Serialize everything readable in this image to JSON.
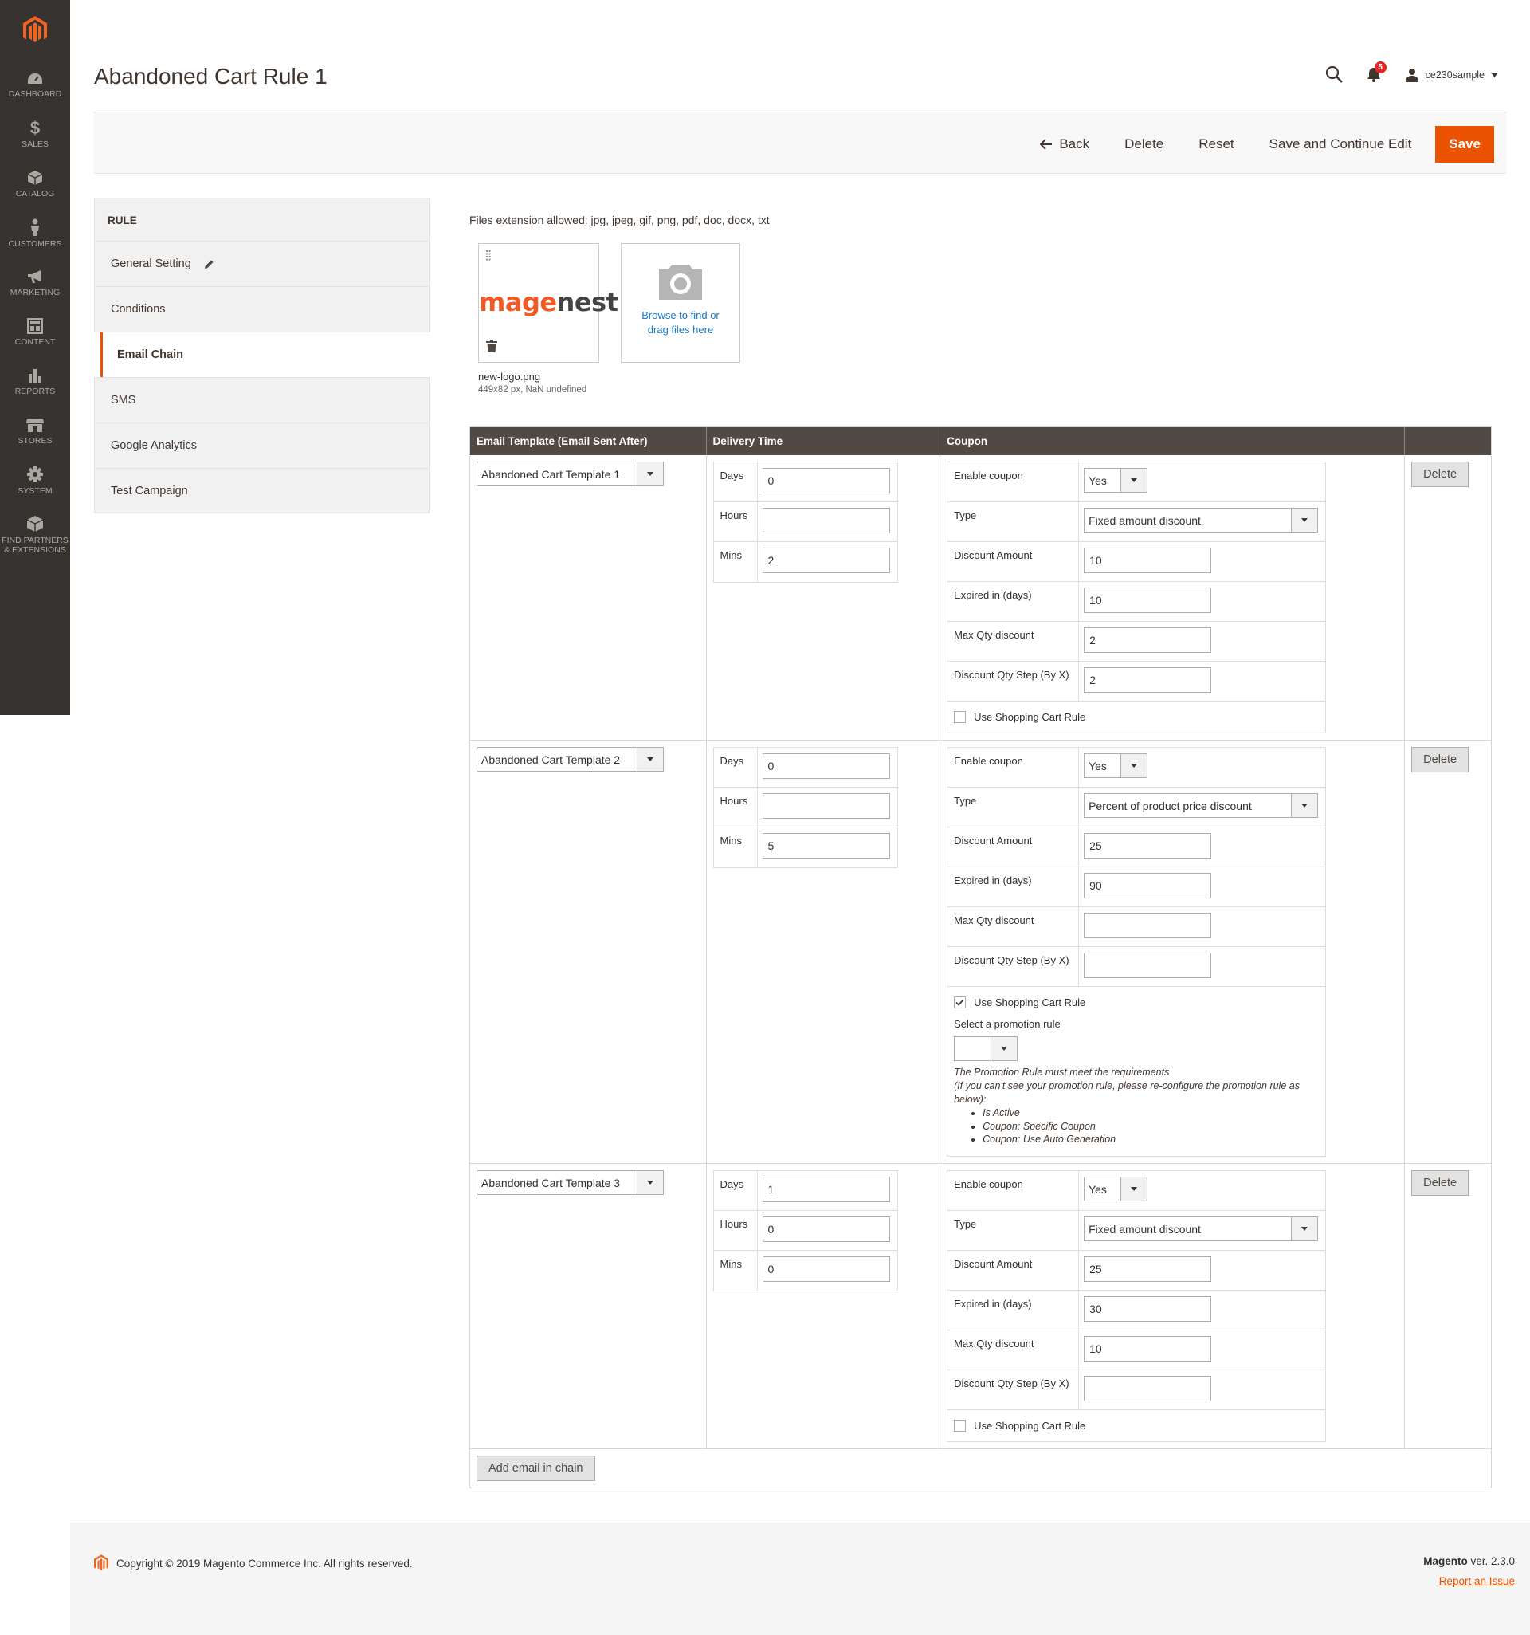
{
  "nav": {
    "items": [
      {
        "label": "DASHBOARD",
        "icon": "dashboard-icon"
      },
      {
        "label": "SALES",
        "icon": "dollar-icon"
      },
      {
        "label": "CATALOG",
        "icon": "box-icon"
      },
      {
        "label": "CUSTOMERS",
        "icon": "person-icon"
      },
      {
        "label": "MARKETING",
        "icon": "megaphone-icon"
      },
      {
        "label": "CONTENT",
        "icon": "layout-icon"
      },
      {
        "label": "REPORTS",
        "icon": "bar-chart-icon"
      },
      {
        "label": "STORES",
        "icon": "store-icon"
      },
      {
        "label": "SYSTEM",
        "icon": "gear-icon"
      },
      {
        "label": "FIND PARTNERS\n& EXTENSIONS",
        "icon": "cube-icon"
      }
    ]
  },
  "header": {
    "title": "Abandoned Cart Rule 1",
    "notifications_count": "5",
    "username": "ce230sample"
  },
  "actions": {
    "back": "Back",
    "delete": "Delete",
    "reset": "Reset",
    "save_continue": "Save and Continue Edit",
    "save": "Save"
  },
  "tabs": {
    "heading": "RULE",
    "items": [
      "General Setting",
      "Conditions",
      "Email Chain",
      "SMS",
      "Google Analytics",
      "Test Campaign"
    ],
    "active": "Email Chain"
  },
  "upload": {
    "note": "Files extension allowed: jpg, jpeg, gif, png, pdf, doc, docx, txt",
    "logo_part1": "mage",
    "logo_part2": "nest",
    "file_name": "new-logo.png",
    "file_meta": "449x82 px, NaN undefined",
    "browse_line1": "Browse to find or",
    "browse_line2": "drag files here"
  },
  "chain": {
    "headers": [
      "Email Template (Email Sent After)",
      "Delivery Time",
      "Coupon",
      ""
    ],
    "labels": {
      "days": "Days",
      "hours": "Hours",
      "mins": "Mins",
      "enable_coupon": "Enable coupon",
      "type": "Type",
      "discount_amount": "Discount Amount",
      "expired": "Expired in (days)",
      "max_qty": "Max Qty discount",
      "qty_step": "Discount Qty Step (By X)",
      "use_rule": "Use Shopping Cart Rule",
      "delete": "Delete",
      "select_promo": "Select a promotion rule"
    },
    "rows": [
      {
        "template": "Abandoned Cart Template 1",
        "days": "0",
        "hours": "",
        "mins": "2",
        "enable": "Yes",
        "type": "Fixed amount discount",
        "amount": "10",
        "expired": "10",
        "max_qty": "2",
        "qty_step": "2",
        "use_rule": false
      },
      {
        "template": "Abandoned Cart Template 2",
        "days": "0",
        "hours": "",
        "mins": "5",
        "enable": "Yes",
        "type": "Percent of product price discount",
        "amount": "25",
        "expired": "90",
        "max_qty": "",
        "qty_step": "",
        "use_rule": true
      },
      {
        "template": "Abandoned Cart Template 3",
        "days": "1",
        "hours": "0",
        "mins": "0",
        "enable": "Yes",
        "type": "Fixed amount discount",
        "amount": "25",
        "expired": "30",
        "max_qty": "10",
        "qty_step": "",
        "use_rule": false
      }
    ],
    "promo_note": {
      "line1": "The Promotion Rule must meet the requirements",
      "line2": "(If you can't see your promotion rule, please re-configure the promotion rule as below):",
      "bullets": [
        "Is Active",
        "Coupon: Specific Coupon",
        "Coupon: Use Auto Generation"
      ]
    },
    "add_button": "Add email in chain"
  },
  "footer": {
    "copyright": "Copyright © 2019 Magento Commerce Inc. All rights reserved.",
    "brand": "Magento",
    "version": "ver. 2.3.0",
    "report": "Report an Issue"
  },
  "colors": {
    "accent": "#eb5202",
    "nav_bg": "#373330",
    "table_head": "#514943",
    "link": "#1979c3"
  }
}
